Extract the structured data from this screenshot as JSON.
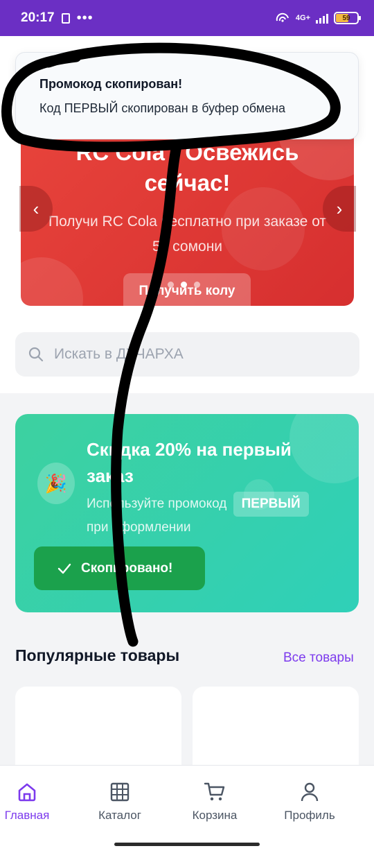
{
  "status_bar": {
    "time": "20:17",
    "network": "4G+",
    "battery": "59"
  },
  "toast": {
    "title": "Промокод скопирован!",
    "text": "Код ПЕРВЫЙ скопирован в буфер обмена"
  },
  "banner": {
    "title": "RC Cola - Освежись сейчас!",
    "subtitle": "Получи RC Cola бесплатно при заказе от 50 сомони",
    "cta": "Получить колу",
    "slides": 3,
    "active_slide": 2
  },
  "search": {
    "placeholder": "Искать в ДУЧАРХА"
  },
  "discount": {
    "title": "Скидка 20% на первый заказ",
    "text_before": "Используйте промокод",
    "code": "ПЕРВЫЙ",
    "text_after": "при оформлении",
    "button": "Скопировано!",
    "icon": "party-popper-icon"
  },
  "popular": {
    "title": "Популярные товары",
    "link": "Все товары"
  },
  "bottom_nav": {
    "items": [
      {
        "label": "Главная",
        "icon": "home-icon",
        "active": true
      },
      {
        "label": "Каталог",
        "icon": "grid-icon",
        "active": false
      },
      {
        "label": "Корзина",
        "icon": "cart-icon",
        "active": false
      },
      {
        "label": "Профиль",
        "icon": "user-icon",
        "active": false
      }
    ]
  },
  "colors": {
    "status_bar": "#6b2fc4",
    "accent": "#7c3aed",
    "banner": "#e03a36",
    "discount": "#36d1a9",
    "copied_button": "#1ba14c",
    "annotation": "#000000"
  }
}
